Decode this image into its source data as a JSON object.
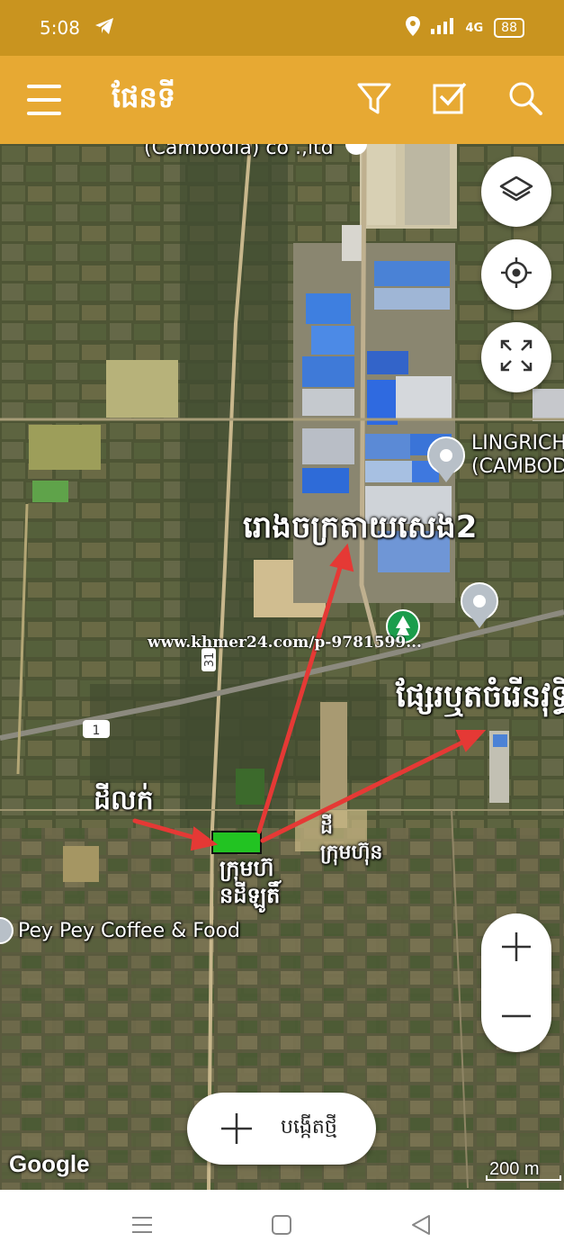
{
  "status_bar": {
    "time": "5:08",
    "network": "4G",
    "battery": "88",
    "icons": [
      "telegram-icon",
      "location-icon",
      "signal-icon",
      "network-4g-icon",
      "battery-icon"
    ]
  },
  "app_bar": {
    "title": "ផែនទី",
    "icons": [
      "menu-icon",
      "filter-icon",
      "checkbox-icon",
      "search-icon"
    ]
  },
  "map": {
    "top_partial_label": "(Cambodia) co .,ltd",
    "poi_lingrich": "LINGRICH\n(CAMBOD",
    "poi_lingrich_line1": "LINGRICH",
    "poi_lingrich_line2": "(CAMBOD",
    "poi_coffee": "Pey Pey Coffee & Food",
    "road_31": "31",
    "road_1": "1",
    "watermark": "www.khmer24.com/p-9781599...",
    "annotations": {
      "factory": "រោងចក្រតាយសេង2",
      "market": "ផ្សែរឬតចំរើនវុទ្ធិ",
      "land": "ដីលក់",
      "company_left_1": "ក្រុមហ៊",
      "company_left_2": "នដីឡូតិ៍",
      "company_right_1": "ដី",
      "company_right_2": "ក្រុមហ៊ុន"
    },
    "google": "Google",
    "scale": "200 m",
    "accent_color": "#e53935",
    "land_marker_color": "#22c322"
  },
  "controls": {
    "layers_icon": "layers-icon",
    "locate_icon": "my-location-icon",
    "fullscreen_icon": "fullscreen-icon",
    "zoom_in": "+",
    "zoom_out": "−",
    "create_label": "បង្កើតថ្មី"
  },
  "nav_bar": {
    "icons": [
      "recents-icon",
      "home-icon",
      "back-icon"
    ]
  }
}
